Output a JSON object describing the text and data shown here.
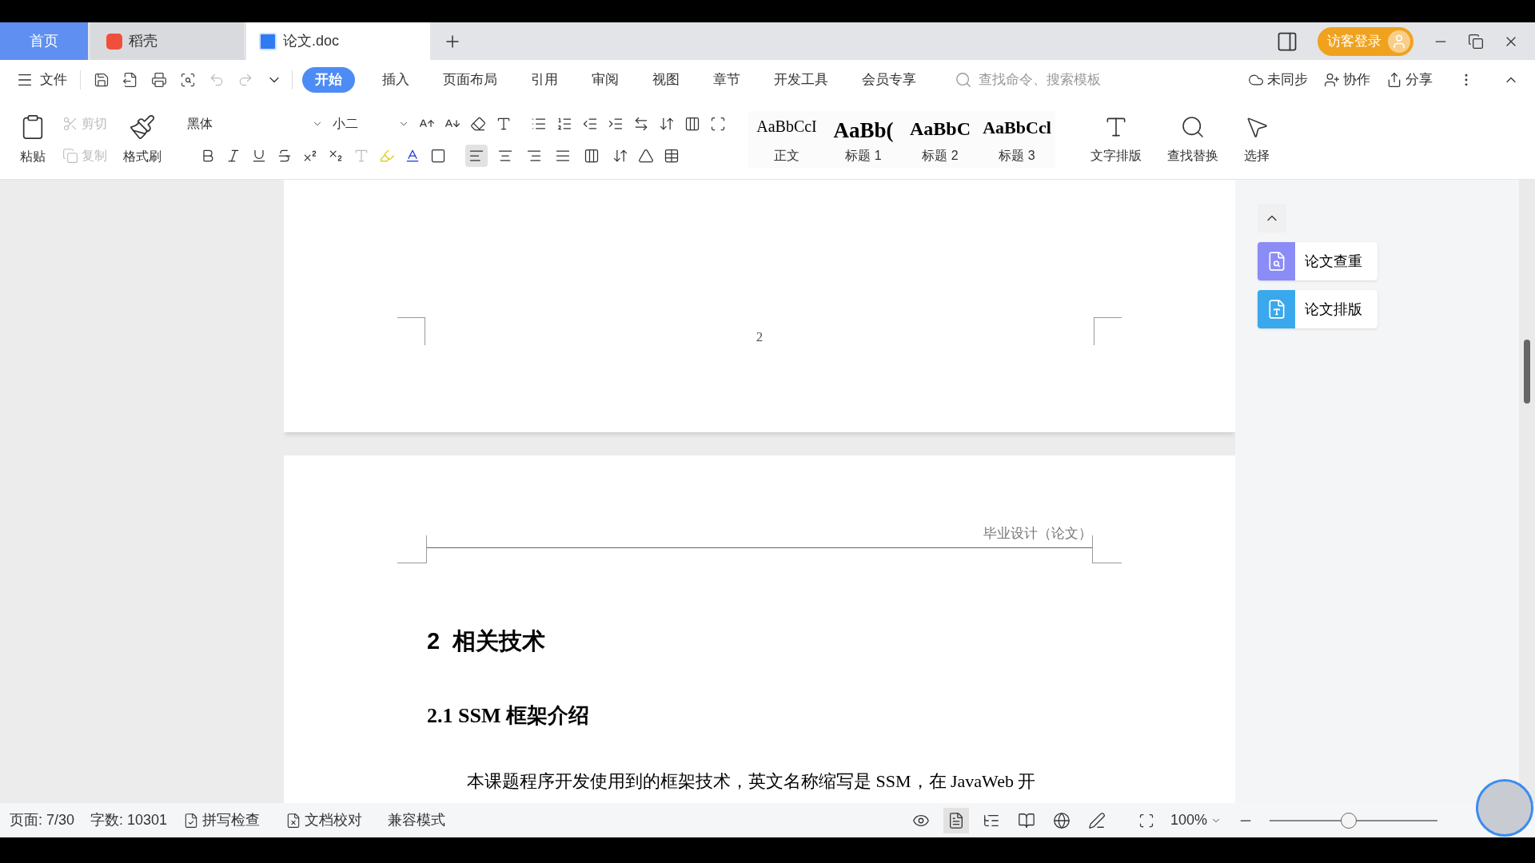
{
  "tabs": [
    {
      "kind": "home",
      "label": "首页",
      "selected": false
    },
    {
      "kind": "app",
      "label": "稻壳",
      "selected": false
    },
    {
      "kind": "doc",
      "label": "论文.doc",
      "selected": true
    }
  ],
  "title_bar": {
    "login": "访客登录"
  },
  "menu": {
    "file": "文件",
    "quick_actions": [
      {
        "kind": "save",
        "disabled": false
      },
      {
        "kind": "export",
        "disabled": false
      },
      {
        "kind": "print",
        "disabled": false
      },
      {
        "kind": "preview",
        "disabled": false
      },
      {
        "kind": "undo",
        "disabled": true
      },
      {
        "kind": "redo",
        "disabled": true
      }
    ],
    "ribbon_tabs": [
      {
        "label": "开始",
        "selected": true
      },
      {
        "label": "插入",
        "selected": false
      },
      {
        "label": "页面布局",
        "selected": false
      },
      {
        "label": "引用",
        "selected": false
      },
      {
        "label": "审阅",
        "selected": false
      },
      {
        "label": "视图",
        "selected": false
      },
      {
        "label": "章节",
        "selected": false
      },
      {
        "label": "开发工具",
        "selected": false
      },
      {
        "label": "会员专享",
        "selected": false
      }
    ],
    "search": {
      "placeholder": "查找命令、搜索模板"
    },
    "actions": [
      {
        "kind": "sync",
        "label": "未同步"
      },
      {
        "kind": "collab",
        "label": "协作"
      },
      {
        "kind": "share",
        "label": "分享"
      }
    ]
  },
  "toolbar": {
    "paste": "粘贴",
    "cut": {
      "label": "剪切",
      "disabled": true
    },
    "copy": {
      "label": "复制",
      "disabled": true
    },
    "format_painter": "格式刷",
    "font": "黑体",
    "size": "小二",
    "align_buttons": [
      {
        "kind": "left",
        "selected": true
      },
      {
        "kind": "center",
        "selected": false
      },
      {
        "kind": "right",
        "selected": false
      },
      {
        "kind": "justify",
        "selected": false
      },
      {
        "kind": "distribute",
        "selected": false
      }
    ],
    "styles": [
      {
        "kind": "normal",
        "preview": "AaBbCcI",
        "label": "正文"
      },
      {
        "kind": "h1",
        "preview": "AaBb(",
        "label": "标题 1"
      },
      {
        "kind": "h2",
        "preview": "AaBbC",
        "label": "标题 2"
      },
      {
        "kind": "h3",
        "preview": "AaBbCcl",
        "label": "标题 3"
      }
    ],
    "big_tools": [
      {
        "kind": "layout",
        "label": "文字排版"
      },
      {
        "kind": "find",
        "label": "查找替换"
      },
      {
        "kind": "select",
        "label": "选择"
      }
    ]
  },
  "document": {
    "page_number": "2",
    "header": "毕业设计（论文）",
    "heading_1": "2  相关技术",
    "heading_2": "2.1 SSM 框架介绍",
    "paragraph": "本课题程序开发使用到的框架技术，英文名称缩写是 SSM，在 JavaWeb 开"
  },
  "side_panel": {
    "items": [
      {
        "kind": "check",
        "label": "论文查重",
        "color": "#8b8cf6"
      },
      {
        "kind": "format",
        "label": "论文排版",
        "color": "#3aa8ec"
      }
    ]
  },
  "status_bar": {
    "page": "页面: 7/30",
    "words": "字数: 10301",
    "spell": "拼写检查",
    "proof": "文档校对",
    "compat": "兼容模式",
    "views": [
      {
        "kind": "read",
        "selected": false
      },
      {
        "kind": "page",
        "selected": true
      },
      {
        "kind": "outline",
        "selected": false
      },
      {
        "kind": "book",
        "selected": false
      },
      {
        "kind": "web",
        "selected": false
      },
      {
        "kind": "write",
        "selected": false
      }
    ],
    "zoom": "100%",
    "zoom_slider": {
      "level": 0.47
    }
  }
}
